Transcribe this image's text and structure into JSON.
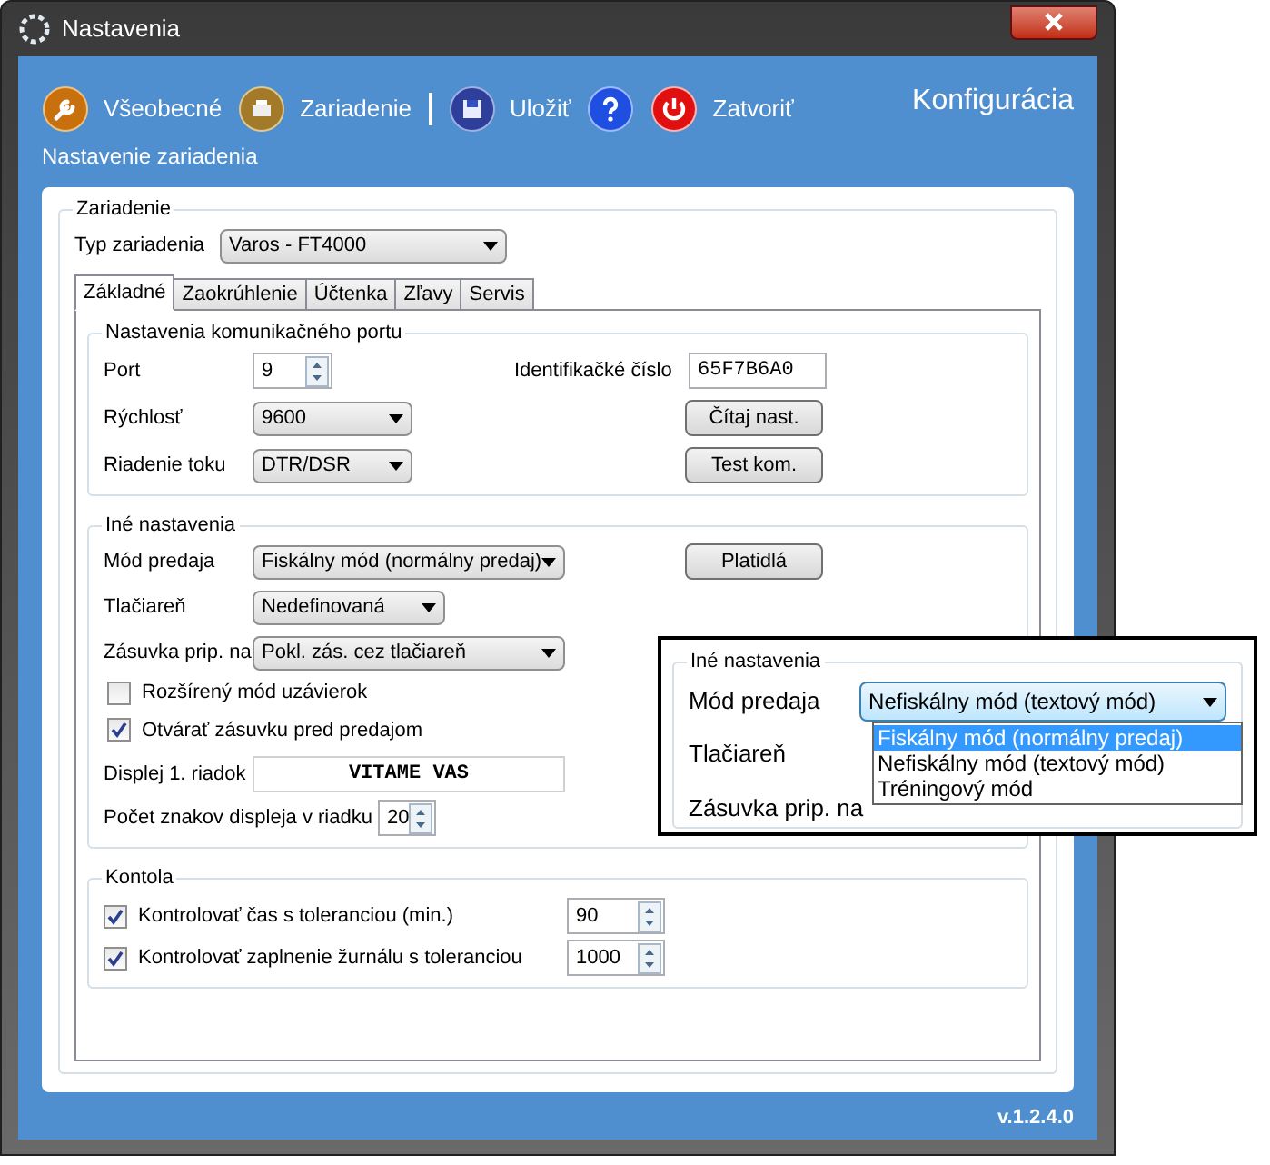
{
  "window": {
    "title": "Nastavenia"
  },
  "toolbar": [
    {
      "label": "Všeobecné",
      "kind": "wrench",
      "separator_after": false
    },
    {
      "label": "Zariadenie",
      "kind": "printer",
      "separator_after": true
    },
    {
      "label": "Uložiť",
      "kind": "disk",
      "separator_after": false
    },
    {
      "kind": "help",
      "separator_after": false
    },
    {
      "label": "Zatvoriť",
      "kind": "power",
      "separator_after": false
    }
  ],
  "heading": "Konfigurácia",
  "subtitle": "Nastavenie zariadenia",
  "device_group": {
    "title": "Zariadenie",
    "type_label": "Typ zariadenia",
    "type_value": "Varos - FT4000"
  },
  "tabs": [
    {
      "label": "Základné",
      "selected": true
    },
    {
      "label": "Zaokrúhlenie",
      "selected": false
    },
    {
      "label": "Účtenka",
      "selected": false
    },
    {
      "label": "Zľavy",
      "selected": false
    },
    {
      "label": "Servis",
      "selected": false
    }
  ],
  "port_group": {
    "title": "Nastavenia komunikačného portu",
    "port": {
      "label": "Port",
      "value": "9"
    },
    "speed": {
      "label": "Rýchlosť",
      "value": "9600"
    },
    "flow": {
      "label": "Riadenie toku",
      "value": "DTR/DSR"
    },
    "id": {
      "label": "Identifikačké číslo",
      "value": "65F7B6A0"
    },
    "buttons": [
      "Čítaj nast.",
      "Test kom."
    ]
  },
  "other_group": {
    "title": "Iné nastavenia",
    "sale_mode": {
      "label": "Mód predaja",
      "value": "Fiskálny mód (normálny predaj)"
    },
    "printer": {
      "label": "Tlačiareň",
      "value": "Nedefinovaná"
    },
    "drawer": {
      "label": "Zásuvka prip. na",
      "value": "Pokl. zás. cez tlačiareň"
    },
    "button": "Platidlá",
    "checkboxes": [
      {
        "label": "Rozšírený mód uzávierok",
        "checked": false
      },
      {
        "label": "Otvárať zásuvku pred predajom",
        "checked": true
      }
    ],
    "display_line": {
      "label": "Displej 1. riadok",
      "value": "VITAME VAS"
    },
    "display_chars": {
      "label": "Počet znakov displeja v riadku",
      "value": "20"
    }
  },
  "control_group": {
    "title": "Kontola",
    "rows": [
      {
        "label": "Kontrolovať čas s toleranciou (min.)",
        "checked": true,
        "value": "90"
      },
      {
        "label": "Kontrolovať zaplnenie žurnálu s toleranciou",
        "checked": true,
        "value": "1000"
      }
    ]
  },
  "version": "v.1.2.4.0",
  "callout": {
    "title": "Iné nastavenia",
    "sale_mode": {
      "label": "Mód predaja",
      "value": "Nefiskálny mód (textový mód)"
    },
    "options": [
      {
        "label": "Fiskálny mód (normálny predaj)",
        "selected": true
      },
      {
        "label": "Nefiskálny mód (textový mód)",
        "selected": false
      },
      {
        "label": "Tréningový mód",
        "selected": false
      }
    ],
    "printer_label": "Tlačiareň",
    "drawer_label": "Zásuvka prip. na"
  }
}
